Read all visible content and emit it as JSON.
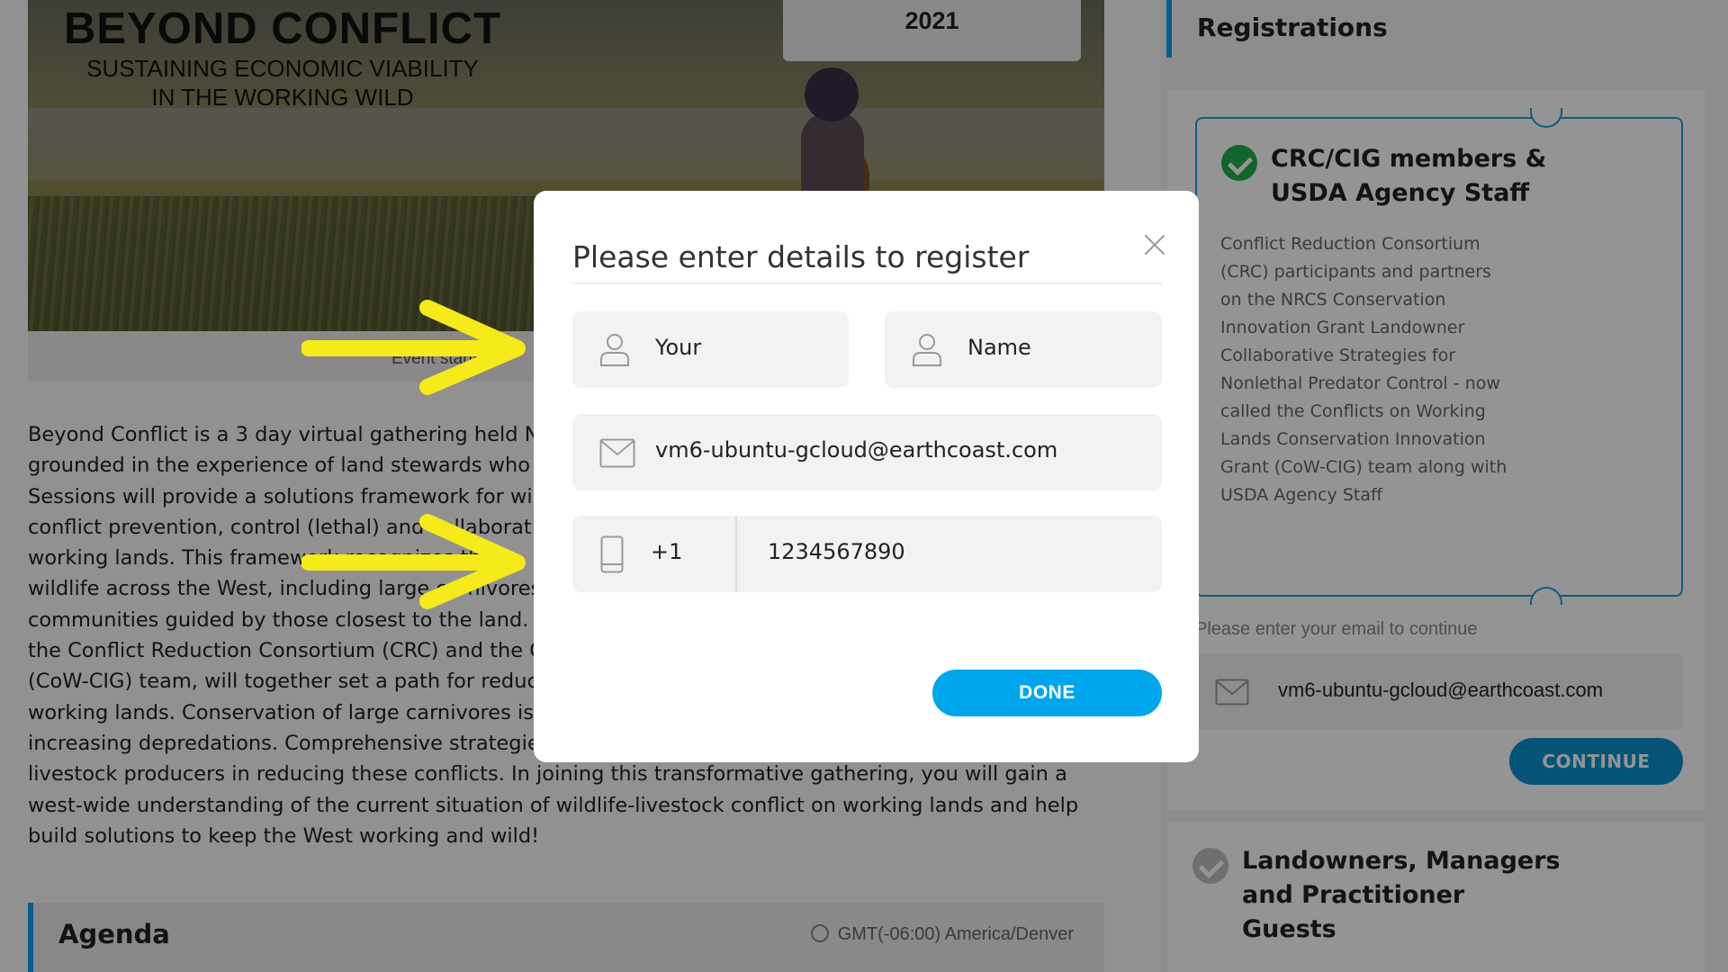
{
  "banner": {
    "title": "BEYOND CONFLICT",
    "subtitle_line1": "SUSTAINING ECONOMIC VIABILITY",
    "subtitle_line2": "IN THE WORKING WILD",
    "year": "2021",
    "event_starts": "Event starts"
  },
  "description": {
    "lines": [
      "Beyond Conflict is a 3 day virtual gathering held No",
      "grounded in the experience of land stewards who",
      "Sessions will provide a solutions framework for wil",
      "conflict prevention, control (lethal) and collaborati",
      "working lands. This framework recognizes the",
      "wildlife across the West, including large carnivores",
      "communities guided by those closest to the land. P",
      "the Conflict Reduction Consortium (CRC) and the C",
      "(CoW-CIG) team, will together set a path for reduci",
      "working lands. Conservation of large carnivores is",
      "increasing depredations. Comprehensive strategie",
      "livestock producers in reducing these conflicts. In joining this transformative gathering, you will gain a",
      "west-wide understanding of the current situation of wildlife-livestock conflict on working lands and help",
      "build solutions to keep the West working and wild!"
    ]
  },
  "agenda": {
    "title": "Agenda",
    "timezone": "GMT(-06:00) America/Denver"
  },
  "sidebar": {
    "title": "Registrations",
    "tier1": {
      "name": "CRC/CIG members & USDA Agency Staff",
      "description": "Conflict Reduction Consortium (CRC) participants and partners on the NRCS Conservation Innovation Grant Landowner Collaborative Strategies for Nonlethal Predator Control - now called the Conflicts on Working Lands Conservation Innovation Grant (CoW-CIG) team along with USDA Agency Staff"
    },
    "email_hint": "Please enter your email to continue",
    "email_value": "vm6-ubuntu-gcloud@earthcoast.com",
    "continue_label": "CONTINUE",
    "tier2": {
      "name": "Landowners, Managers and Practitioner Guests"
    }
  },
  "modal": {
    "title": "Please enter details to register",
    "first_name": "Your",
    "last_name": "Name",
    "email": "vm6-ubuntu-gcloud@earthcoast.com",
    "country_code": "+1",
    "phone": "1234567890",
    "done_label": "DONE"
  },
  "colors": {
    "accent": "#00a6ec",
    "success": "#1fae4b",
    "annotation_arrow": "#f5ea1a"
  }
}
